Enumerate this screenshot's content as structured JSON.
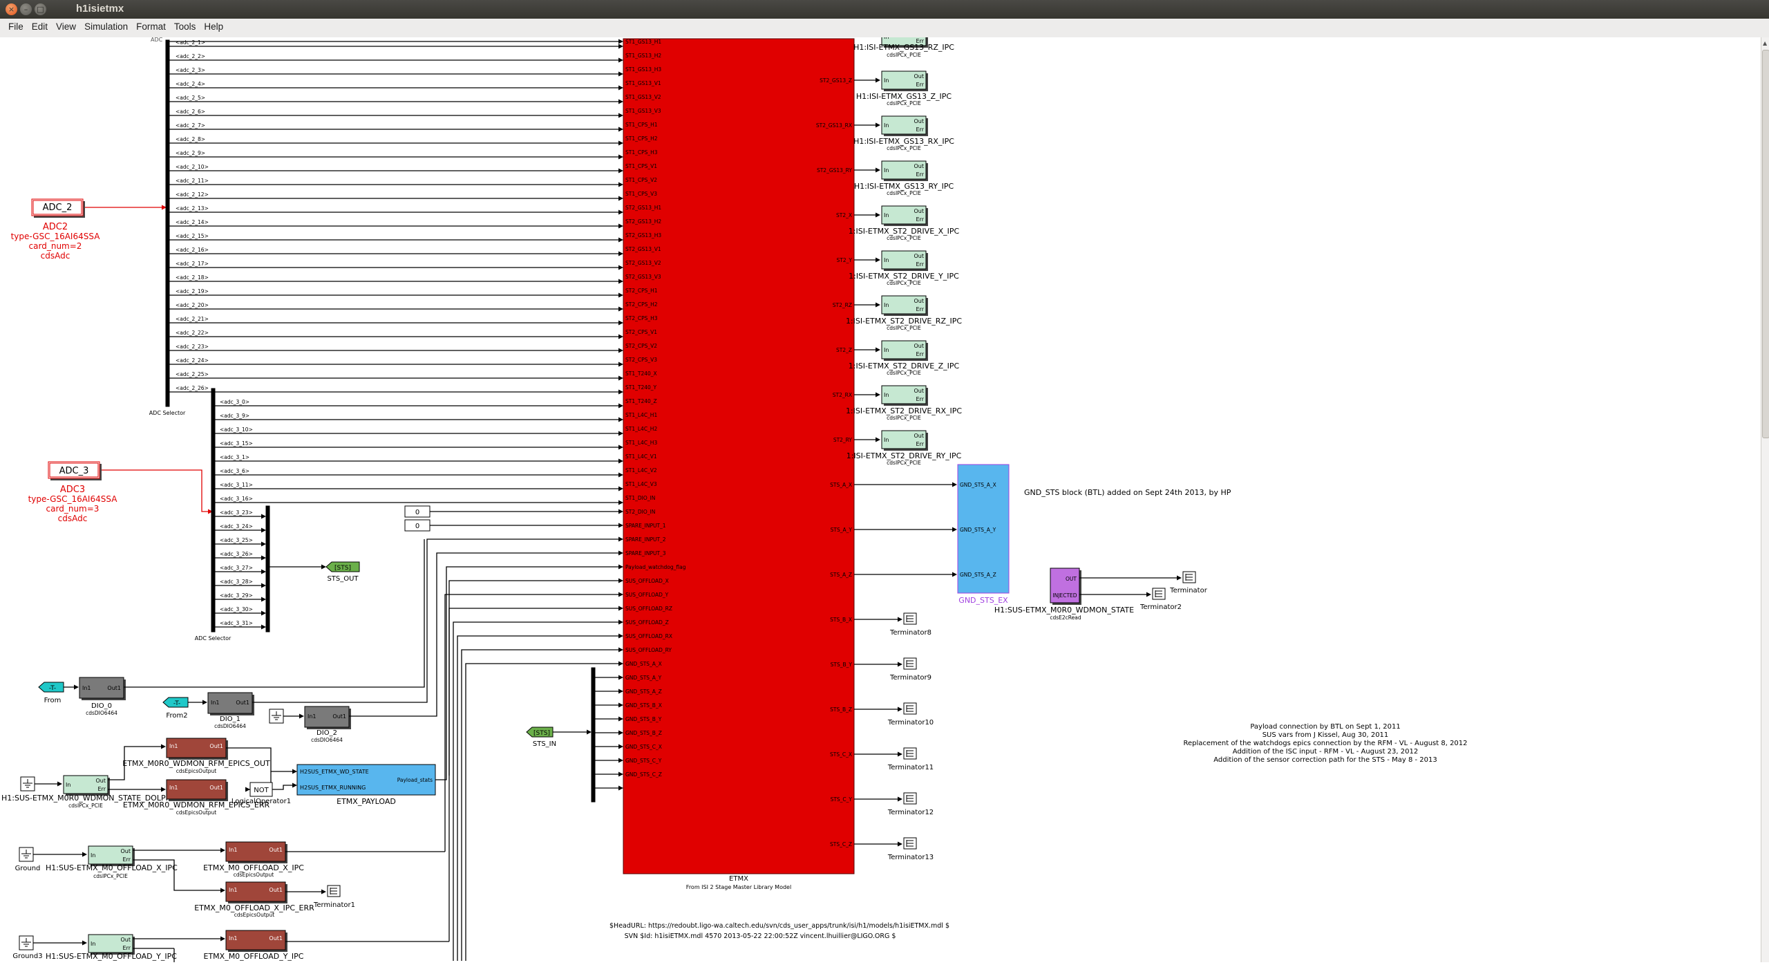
{
  "window": {
    "title": "h1isietmx"
  },
  "menu": [
    "File",
    "Edit",
    "View",
    "Simulation",
    "Format",
    "Tools",
    "Help"
  ],
  "blocks": {
    "adc2": {
      "name": "ADC_2",
      "label1": "ADC2",
      "label2": "type-GSC_16AI64SSA",
      "label3": "card_num=2",
      "label4": "cdsAdc"
    },
    "adc3": {
      "name": "ADC_3",
      "label1": "ADC3",
      "label2": "type-GSC_16AI64SSA",
      "label3": "card_num=3",
      "label4": "cdsAdc"
    },
    "adc_selector_1": {
      "label": "ADC Selector",
      "top_label": "ADC"
    },
    "adc_selector_2": {
      "label": "ADC Selector"
    },
    "const1": "0",
    "const2": "0",
    "sts_out": {
      "tag": "[STS]",
      "label": "STS_OUT"
    },
    "sts_in": {
      "tag": "[STS]",
      "label": "STS_IN"
    },
    "from1": {
      "tag": "-T-",
      "label": "From"
    },
    "from2": {
      "tag": "-T-",
      "label": "From2"
    },
    "dio0": {
      "label": "DIO_0",
      "sub": "cdsDIO6464",
      "in": "In1",
      "out": "Out1"
    },
    "dio1": {
      "label": "DIO_1",
      "sub": "cdsDIO6464",
      "in": "In1",
      "out": "Out1"
    },
    "dio2": {
      "label": "DIO_2",
      "sub": "cdsDIO6464",
      "in": "In1",
      "out": "Out1"
    },
    "epics_out": {
      "label": "ETMX_M0R0_WDMON_RFM_EPICS_OUT",
      "sub": "cdsEpicsOutput",
      "in": "In1",
      "out": "Out1"
    },
    "epics_err": {
      "label": "ETMX_M0R0_WDMON_RFM_EPICS_ERR",
      "sub": "cdsEpicsOutput",
      "in": "In1",
      "out": "Out1"
    },
    "ipc_dolphin": {
      "label": "H1:SUS-ETMX_M0R0_WDMON_STATE_DOLPHIN",
      "sub": "cdsIPCx_PCIE",
      "in": "In",
      "out1": "Out",
      "out2": "Err"
    },
    "logical_op": {
      "label": "LogicalOperator1",
      "text": "NOT"
    },
    "payload": {
      "label": "ETMX_PAYLOAD",
      "port1": "H2SUS_ETMX_WD_STATE",
      "port2": "H2SUS_ETMX_RUNNING",
      "out": "Payload_stats"
    },
    "ground": {
      "label": "Ground"
    },
    "ground3": {
      "label": "Ground3"
    },
    "ipc_off_x": {
      "label": "H1:SUS-ETMX_M0_OFFLOAD_X_IPC",
      "sub": "cdsIPCx_PCIE",
      "in": "In",
      "out1": "Out",
      "out2": "Err"
    },
    "ipc_off_y": {
      "label": "H1:SUS-ETMX_M0_OFFLOAD_Y_IPC",
      "in": "In",
      "out1": "Out",
      "out2": "Err"
    },
    "off_x": {
      "label": "ETMX_M0_OFFLOAD_X_IPC",
      "sub": "cdsEpicsOutput",
      "in": "In1",
      "out": "Out1"
    },
    "off_x_err": {
      "label": "ETMX_M0_OFFLOAD_X_IPC_ERR",
      "sub": "cdsEpicsOutput",
      "in": "In1",
      "out": "Out1"
    },
    "off_y": {
      "label": "ETMX_M0_OFFLOAD_Y_IPC",
      "in": "In1",
      "out": "Out1"
    },
    "terminator1": "Terminator1",
    "etmx": {
      "label": "ETMX",
      "sub": "From ISI 2 Stage Master Library Model"
    },
    "gnd_sts": {
      "label": "GND_STS_EX",
      "ports": [
        "GND_STS_A_X",
        "GND_STS_A_Y",
        "GND_STS_A_Z"
      ]
    },
    "wdmon": {
      "label": "H1:SUS-ETMX_M0R0_WDMON_STATE",
      "sub": "cdsE2cRead",
      "p1": "OUT",
      "p2": "INJECTED"
    },
    "terminator": "Terminator",
    "terminator2": "Terminator2"
  },
  "adc2_channels": [
    "<adc_2_1>",
    "<adc_2_2>",
    "<adc_2_3>",
    "<adc_2_4>",
    "<adc_2_5>",
    "<adc_2_6>",
    "<adc_2_7>",
    "<adc_2_8>",
    "<adc_2_9>",
    "<adc_2_10>",
    "<adc_2_11>",
    "<adc_2_12>",
    "<adc_2_13>",
    "<adc_2_14>",
    "<adc_2_15>",
    "<adc_2_16>",
    "<adc_2_17>",
    "<adc_2_18>",
    "<adc_2_19>",
    "<adc_2_20>",
    "<adc_2_21>",
    "<adc_2_22>",
    "<adc_2_23>",
    "<adc_2_24>",
    "<adc_2_25>",
    "<adc_2_26>"
  ],
  "adc3_channels": [
    "<adc_3_0>",
    "<adc_3_9>",
    "<adc_3_10>",
    "<adc_3_15>",
    "<adc_3_1>",
    "<adc_3_6>",
    "<adc_3_11>",
    "<adc_3_16>"
  ],
  "adc3_unused": [
    "<adc_3_23>",
    "<adc_3_24>",
    "<adc_3_25>",
    "<adc_3_26>",
    "<adc_3_27>",
    "<adc_3_28>",
    "<adc_3_29>",
    "<adc_3_30>",
    "<adc_3_31>"
  ],
  "etmx_inputs": [
    "ST1_GS13_H1",
    "ST1_GS13_H2",
    "ST1_GS13_H3",
    "ST1_GS13_V1",
    "ST1_GS13_V2",
    "ST1_GS13_V3",
    "ST1_CPS_H1",
    "ST1_CPS_H2",
    "ST1_CPS_H3",
    "ST1_CPS_V1",
    "ST1_CPS_V2",
    "ST1_CPS_V3",
    "ST2_GS13_H1",
    "ST2_GS13_H2",
    "ST2_GS13_H3",
    "ST2_GS13_V1",
    "ST2_GS13_V2",
    "ST2_GS13_V3",
    "ST2_CPS_H1",
    "ST2_CPS_H2",
    "ST2_CPS_H3",
    "ST2_CPS_V1",
    "ST2_CPS_V2",
    "ST2_CPS_V3",
    "ST1_T240_X",
    "ST1_T240_Y",
    "ST1_T240_Z",
    "ST1_L4C_H1",
    "ST1_L4C_H2",
    "ST1_L4C_H3",
    "ST1_L4C_V1",
    "ST1_L4C_V2",
    "ST1_L4C_V3",
    "ST1_DIO_IN",
    "ST2_DIO_IN",
    "SPARE_INPUT_1",
    "SPARE_INPUT_2",
    "SPARE_INPUT_3",
    "Payload_watchdog_flag",
    "SUS_OFFLOAD_X",
    "SUS_OFFLOAD_Y",
    "SUS_OFFLOAD_RZ",
    "SUS_OFFLOAD_Z",
    "SUS_OFFLOAD_RX",
    "SUS_OFFLOAD_RY",
    "GND_STS_A_X",
    "GND_STS_A_Y",
    "GND_STS_A_Z",
    "GND_STS_B_X",
    "GND_STS_B_Y",
    "GND_STS_B_Z",
    "GND_STS_C_X",
    "GND_STS_C_Y",
    "GND_STS_C_Z"
  ],
  "etmx_outputs": [
    "ST2_GS13_Z",
    "ST2_GS13_RX",
    "ST2_GS13_RY",
    "ST2_X",
    "ST2_Y",
    "ST2_RZ",
    "ST2_Z",
    "ST2_RX",
    "ST2_RY",
    "STS_A_X",
    "STS_A_Y",
    "STS_A_Z",
    "STS_B_X",
    "STS_B_Y",
    "STS_B_Z",
    "STS_C_X",
    "STS_C_Y",
    "STS_C_Z"
  ],
  "ipc_outputs": [
    {
      "label": "H1:ISI-ETMX_GS13_Z_IPC",
      "sub": "cdsIPCx_PCIE"
    },
    {
      "label": "H1:ISI-ETMX_GS13_RX_IPC",
      "sub": "cdsIPCx_PCIE"
    },
    {
      "label": "H1:ISI-ETMX_GS13_RY_IPC",
      "sub": "cdsIPCx_PCIE"
    },
    {
      "label": "1:ISI-ETMX_ST2_DRIVE_X_IPC",
      "sub": "cdsIPCx_PCIE"
    },
    {
      "label": "1:ISI-ETMX_ST2_DRIVE_Y_IPC",
      "sub": "cdsIPCx_PCIE"
    },
    {
      "label": "1:ISI-ETMX_ST2_DRIVE_RZ_IPC",
      "sub": "cdsIPCx_PCIE"
    },
    {
      "label": "1:ISI-ETMX_ST2_DRIVE_Z_IPC",
      "sub": "cdsIPCx_PCIE"
    },
    {
      "label": "1:ISI-ETMX_ST2_DRIVE_RX_IPC",
      "sub": "cdsIPCx_PCIE"
    },
    {
      "label": "1:ISI-ETMX_ST2_DRIVE_RY_IPC",
      "sub": "cdsIPCx_PCIE"
    }
  ],
  "top_ipc": {
    "label": "H1:ISI-ETMX_GS13_RZ_IPC",
    "sub": "cdsIPCx_PCIE"
  },
  "ipc_ports": {
    "in": "In",
    "out": "Out",
    "err": "Err"
  },
  "terminators": [
    "Terminator8",
    "Terminator9",
    "Terminator10",
    "Terminator11",
    "Terminator12",
    "Terminator13"
  ],
  "sts_bus": [
    "STS_A_X",
    "STS_A_Y",
    "STS_A_Z",
    "STS_B_X",
    "STS_B_Y",
    "STS_B_Z",
    "STS_C_X",
    "STS_C_Y",
    "STS_C_Z"
  ],
  "notes": {
    "gnd_sts_note": "GND_STS  block (BTL) added on Sept 24th 2013, by HP",
    "history": [
      "Payload connection by BTL on Sept 1, 2011",
      "SUS vars from J Kissel, Aug 30, 2011",
      "Replacement of the watchdogs epics connection by the RFM - VL - August 8, 2012",
      "Addition of the ISC input - RFM - VL - August 23, 2012",
      "Addition of the sensor correction path for the STS - May 8 - 2013"
    ],
    "headurl": "$HeadURL: https://redoubt.ligo-wa.caltech.edu/svn/cds_user_apps/trunk/isi/h1/models/h1isiETMX.mdl $",
    "svnid": "SVN $Id: h1isiETMX.mdl 4570 2013-05-22 22:00:52Z vincent.lhuillier@LIGO.ORG $"
  },
  "colors": {
    "red": "#e00000",
    "ipc": "#c6e8d2",
    "epics": "#a0463a",
    "gray": "#7a7a7a",
    "cyan": "#20c8c8",
    "green": "#6bb04a",
    "blue": "#58b6ee",
    "purple": "#c070e0",
    "note_red": "#e00000"
  }
}
